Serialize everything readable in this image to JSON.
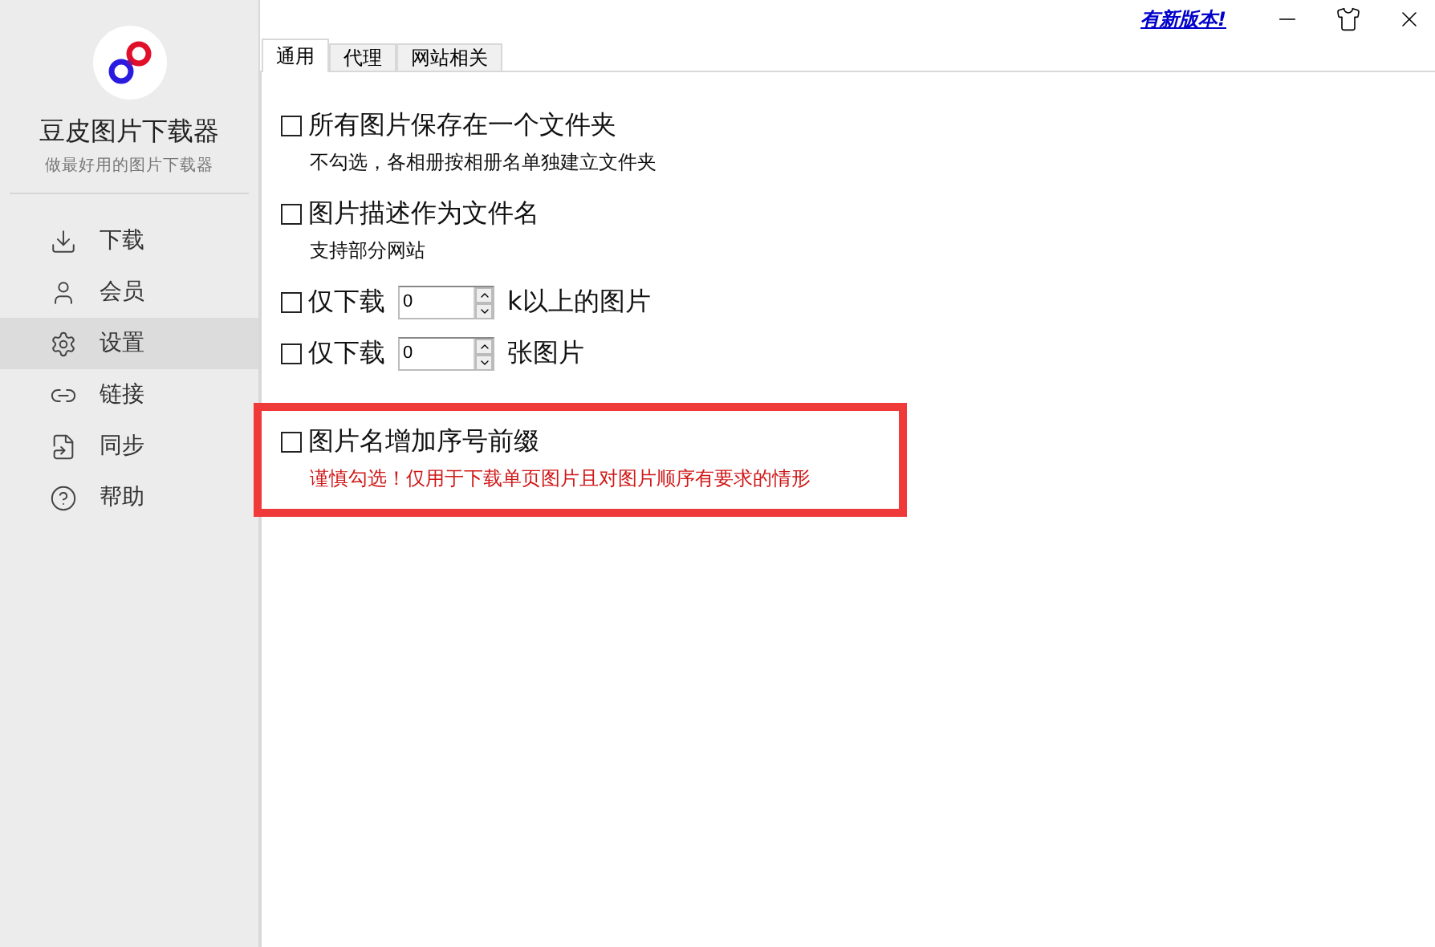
{
  "app": {
    "title": "豆皮图片下载器",
    "subtitle": "做最好用的图片下载器"
  },
  "nav": [
    {
      "label": "下载",
      "selected": false
    },
    {
      "label": "会员",
      "selected": false
    },
    {
      "label": "设置",
      "selected": true
    },
    {
      "label": "链接",
      "selected": false
    },
    {
      "label": "同步",
      "selected": false
    },
    {
      "label": "帮助",
      "selected": false
    }
  ],
  "top_bar": {
    "update_link": "有新版本!"
  },
  "tabs": [
    {
      "label": "通用",
      "selected": true
    },
    {
      "label": "代理",
      "selected": false
    },
    {
      "label": "网站相关",
      "selected": false
    }
  ],
  "options": [
    {
      "kind": "checkbox",
      "label": "所有图片保存在一个文件夹",
      "checked": false,
      "note": "不勾选，各相册按相册名单独建立文件夹",
      "highlighted": false
    },
    {
      "kind": "checkbox",
      "label": "图片描述作为文件名",
      "checked": false,
      "note": "支持部分网站",
      "highlighted": false
    },
    {
      "kind": "spinner",
      "label": "仅下载",
      "checked": false,
      "value": "0",
      "suffix": "k以上的图片",
      "highlighted": false
    },
    {
      "kind": "spinner",
      "label": "仅下载",
      "checked": false,
      "value": "0",
      "suffix": "张图片",
      "highlighted": false
    },
    {
      "kind": "checkbox",
      "label": "图片名增加序号前缀",
      "checked": false,
      "note": "谨慎勾选！仅用于下载单页图片且对图片顺序有要求的情形",
      "highlighted": true
    }
  ]
}
